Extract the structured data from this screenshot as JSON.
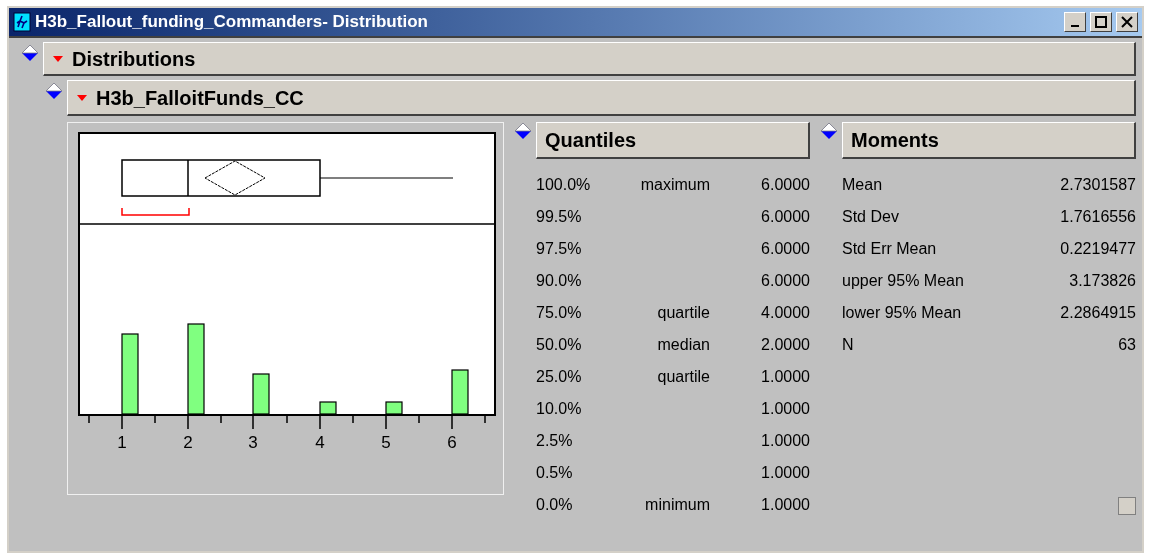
{
  "window": {
    "title": "H3b_Fallout_funding_Commanders- Distribution"
  },
  "outline": {
    "title": "Distributions",
    "expanded": true
  },
  "variable": {
    "title": "H3b_FalloitFunds_CC",
    "expanded": true
  },
  "histogram": {
    "axis_labels": [
      "1",
      "2",
      "3",
      "4",
      "5",
      "6"
    ]
  },
  "quantiles": {
    "title": "Quantiles",
    "rows": [
      {
        "percent": "100.0%",
        "label": "maximum",
        "value": "6.0000"
      },
      {
        "percent": "99.5%",
        "value": "6.0000"
      },
      {
        "percent": "97.5%",
        "value": "6.0000"
      },
      {
        "percent": "90.0%",
        "value": "6.0000"
      },
      {
        "percent": "75.0%",
        "label": "quartile",
        "value": "4.0000"
      },
      {
        "percent": "50.0%",
        "label": "median",
        "value": "2.0000"
      },
      {
        "percent": "25.0%",
        "label": "quartile",
        "value": "1.0000"
      },
      {
        "percent": "10.0%",
        "value": "1.0000"
      },
      {
        "percent": "2.5%",
        "value": "1.0000"
      },
      {
        "percent": "0.5%",
        "value": "1.0000"
      },
      {
        "percent": "0.0%",
        "label": "minimum",
        "value": "1.0000"
      }
    ]
  },
  "moments": {
    "title": "Moments",
    "rows": [
      {
        "label": "Mean",
        "value": "2.7301587"
      },
      {
        "label": "Std Dev",
        "value": "1.7616556"
      },
      {
        "label": "Std Err Mean",
        "value": "0.2219477"
      },
      {
        "label": "upper 95% Mean",
        "value": "3.173826"
      },
      {
        "label": "lower 95% Mean",
        "value": "2.2864915"
      },
      {
        "label": "N",
        "value": "63"
      }
    ]
  }
}
